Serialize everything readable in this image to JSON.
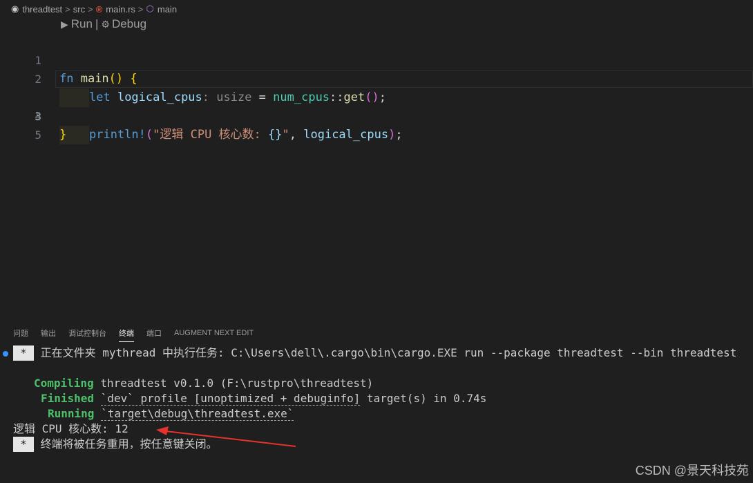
{
  "breadcrumb": {
    "folder": "threadtest",
    "src": "src",
    "file": "main.rs",
    "symbol": "main",
    "separator": ">"
  },
  "codelens": {
    "run": "Run",
    "pipe": "|",
    "debug": "Debug"
  },
  "editor": {
    "line_numbers": [
      "1",
      "2",
      "3",
      "4",
      "5"
    ],
    "active_line": "3",
    "tokens": {
      "l1_fn": "fn ",
      "l1_main": "main",
      "l1_parens": "() ",
      "l1_brace": "{",
      "l2_let": "let ",
      "l2_var": "logical_cpus",
      "l2_hint": ": usize",
      "l2_eq": " = ",
      "l2_ns": "num_cpus",
      "l2_colons": "::",
      "l2_get": "get",
      "l2_parens": "()",
      "l2_semi": ";",
      "l3_macro": "println!",
      "l3_open": "(",
      "l3_str1": "\"逻辑 CPU 核心数: ",
      "l3_fmt": "{}",
      "l3_str2": "\"",
      "l3_comma": ", ",
      "l3_var": "logical_cpus",
      "l3_close": ")",
      "l3_semi": ";",
      "l4_brace": "}"
    }
  },
  "panel": {
    "tabs": [
      "问题",
      "输出",
      "调试控制台",
      "终端",
      "端口",
      "AUGMENT NEXT EDIT"
    ],
    "active_tab": "终端"
  },
  "terminal": {
    "star": "*",
    "task_line": " 正在文件夹 mythread 中执行任务: C:\\Users\\dell\\.cargo\\bin\\cargo.EXE run --package threadtest --bin threadtest",
    "compiling_label": "Compiling",
    "compiling_text": " threadtest v0.1.0 (F:\\rustpro\\threadtest)",
    "finished_label": "Finished",
    "finished_profile": "`dev` profile [unoptimized + debuginfo]",
    "finished_text": " target(s) in 0.74s",
    "running_label": "Running",
    "running_text": "`target\\debug\\threadtest.exe`",
    "output_line": "逻辑 CPU 核心数: 12",
    "reuse_line": " 终端将被任务重用，按任意键关闭。"
  },
  "watermark": "CSDN @景天科技苑",
  "colors": {
    "background": "#1f1f1f",
    "green": "#4ec06b",
    "arrow": "#e8322f",
    "active_dot": "#3794ff"
  }
}
